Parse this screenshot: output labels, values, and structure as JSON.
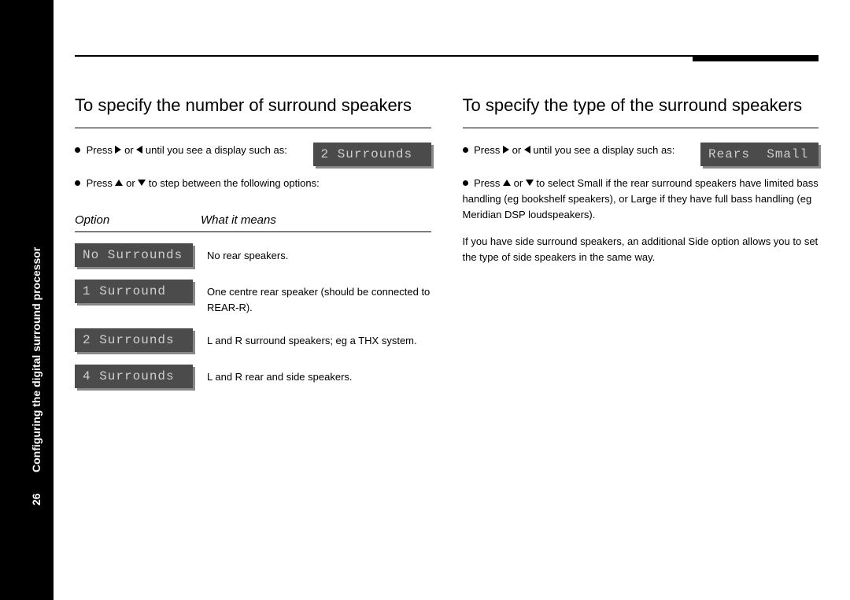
{
  "sidebar": {
    "page_number": "26",
    "title": "Configuring the digital surround processor"
  },
  "left": {
    "heading": "To specify the number of surround speakers",
    "instr1_pre": "Press ",
    "instr1_mid": " or ",
    "instr1_post": " until you see a display such as:",
    "display1": "2 Surrounds",
    "instr2_pre": "Press ",
    "instr2_mid": " or ",
    "instr2_post": " to step between the following options:",
    "table": {
      "header_option": "Option",
      "header_meaning": "What it means",
      "rows": [
        {
          "display": "No Surrounds",
          "desc": "No rear speakers."
        },
        {
          "display": "1 Surround",
          "desc": "One centre rear speaker (should be connected to REAR-R)."
        },
        {
          "display": "2 Surrounds",
          "desc": "L and R surround speakers; eg a THX system."
        },
        {
          "display": "4 Surrounds",
          "desc": "L and R rear and side speakers."
        }
      ]
    }
  },
  "right": {
    "heading": "To specify the type of the surround speakers",
    "instr1_pre": "Press ",
    "instr1_mid": " or ",
    "instr1_post": " until you see a display such as:",
    "display1": "Rears  Small",
    "instr2_pre": "Press ",
    "instr2_mid": " or ",
    "instr2_post": " to select Small if the rear surround speakers have limited bass handling (eg bookshelf speakers), or Large if they have full bass handling (eg Meridian DSP loudspeakers).",
    "paragraph": "If you have side surround speakers, an additional Side option allows you to set the type of side speakers in the same way."
  }
}
